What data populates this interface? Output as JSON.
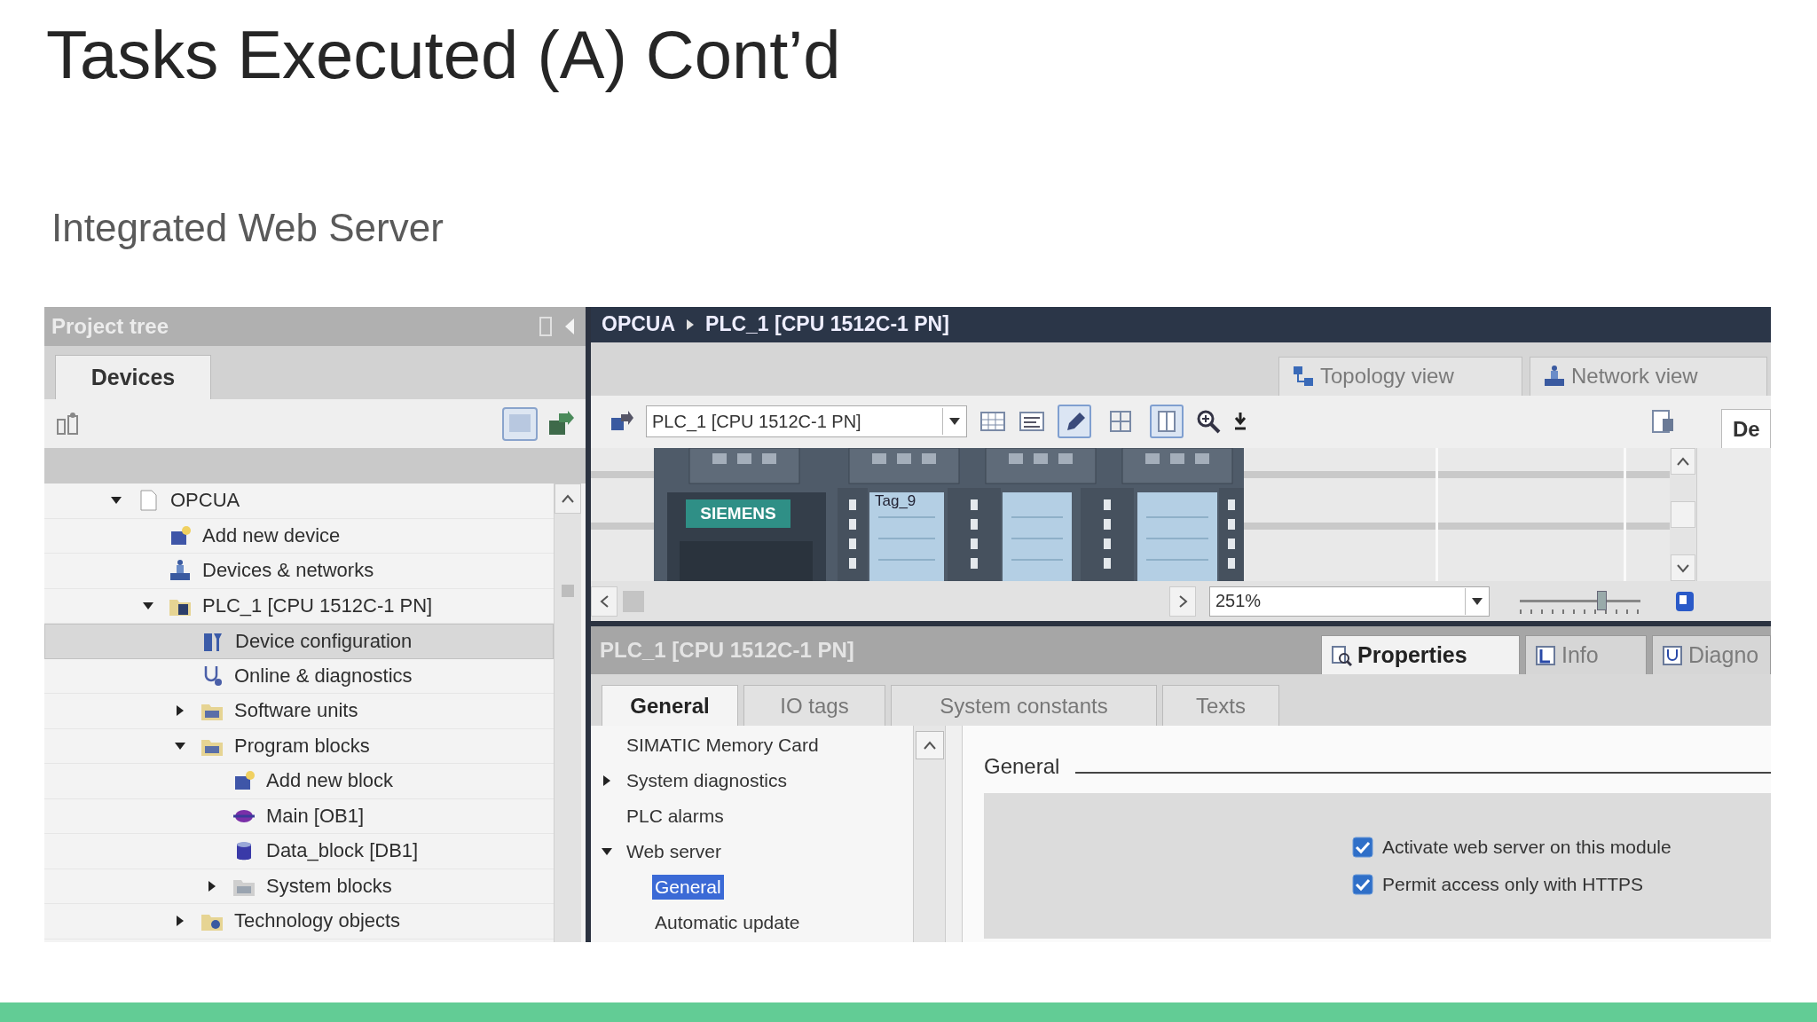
{
  "slide": {
    "title": "Tasks Executed (A) Cont’d",
    "subtitle": "Integrated Web Server"
  },
  "project_tree": {
    "title": "Project tree",
    "tabs": [
      {
        "label": "Devices",
        "selected": true
      }
    ],
    "items": [
      {
        "label": "OPCUA",
        "kind": "page",
        "expanded": true,
        "selected": false,
        "children": [
          {
            "label": "Add new device",
            "kind": "add",
            "selected": false
          },
          {
            "label": "Devices & networks",
            "kind": "network",
            "selected": false
          },
          {
            "label": "PLC_1 [CPU 1512C-1 PN]",
            "kind": "plc",
            "expanded": true,
            "selected": false,
            "children": [
              {
                "label": "Device configuration",
                "kind": "config",
                "selected": true
              },
              {
                "label": "Online & diagnostics",
                "kind": "diag",
                "selected": false
              },
              {
                "label": "Software units",
                "kind": "folder",
                "expanded": false,
                "selected": false
              },
              {
                "label": "Program blocks",
                "kind": "folder",
                "expanded": true,
                "selected": false,
                "children": [
                  {
                    "label": "Add new block",
                    "kind": "add",
                    "selected": false
                  },
                  {
                    "label": "Main [OB1]",
                    "kind": "ob",
                    "selected": false
                  },
                  {
                    "label": "Data_block [DB1]",
                    "kind": "db",
                    "selected": false
                  },
                  {
                    "label": "System blocks",
                    "kind": "sysfolder",
                    "expanded": false,
                    "selected": false
                  }
                ]
              },
              {
                "label": "Technology objects",
                "kind": "tech",
                "expanded": false,
                "selected": false
              }
            ]
          }
        ]
      }
    ]
  },
  "editor": {
    "breadcrumb": [
      "OPCUA",
      "PLC_1 [CPU 1512C-1 PN]"
    ],
    "view_tabs": [
      {
        "label": "Topology view",
        "selected": false
      },
      {
        "label": "Network view",
        "selected": false
      }
    ],
    "device_dropdown": {
      "value": "PLC_1 [CPU 1512C-1 PN]"
    },
    "toolbar_toggles": [
      {
        "pressed": true
      },
      {
        "pressed": false
      },
      {
        "pressed": true
      }
    ],
    "side_tab": "De",
    "device": {
      "brand": "SIEMENS",
      "tag": "Tag_9"
    },
    "zoom_field": {
      "value": "251%"
    },
    "zoom_slider": {
      "level": 0.67
    }
  },
  "inspector": {
    "title": "PLC_1 [CPU 1512C-1 PN]",
    "tabs": [
      {
        "label": "Properties",
        "selected": true
      },
      {
        "label": "Info",
        "selected": false
      },
      {
        "label": "Diagno",
        "selected": false
      }
    ],
    "subtabs": [
      {
        "label": "General",
        "selected": true
      },
      {
        "label": "IO tags",
        "selected": false
      },
      {
        "label": "System constants",
        "selected": false
      },
      {
        "label": "Texts",
        "selected": false
      }
    ],
    "nav": [
      {
        "label": "SIMATIC Memory Card",
        "selected": false
      },
      {
        "label": "System diagnostics",
        "expanded": false,
        "selected": false
      },
      {
        "label": "PLC alarms",
        "selected": false
      },
      {
        "label": "Web server",
        "expanded": true,
        "selected": false,
        "children": [
          {
            "label": "General",
            "selected": true
          },
          {
            "label": "Automatic update",
            "selected": false
          }
        ]
      }
    ],
    "section_title": "General",
    "options": [
      {
        "label": "Activate web server on this module",
        "checked": true
      },
      {
        "label": "Permit access only with HTTPS",
        "checked": true
      }
    ]
  }
}
